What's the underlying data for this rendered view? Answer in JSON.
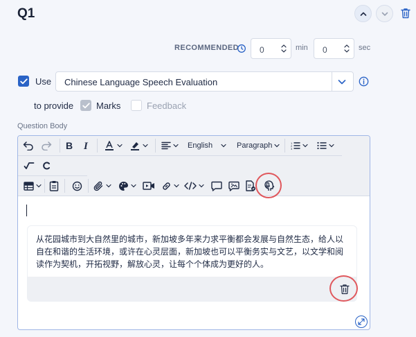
{
  "question": {
    "title": "Q1"
  },
  "timing": {
    "recommended_label": "RECOMMENDED",
    "minutes_value": "0",
    "minutes_unit": "min",
    "seconds_value": "0",
    "seconds_unit": "sec"
  },
  "use_row": {
    "checkbox_checked": true,
    "use_label": "Use",
    "selected_option": "Chinese Language Speech Evaluation"
  },
  "provide_row": {
    "label": "to provide",
    "marks_label": "Marks",
    "marks_checked": true,
    "feedback_label": "Feedback",
    "feedback_checked": false
  },
  "body": {
    "label": "Question Body"
  },
  "toolbar": {
    "language": "English",
    "block_format": "Paragraph",
    "icons": [
      "undo-icon",
      "redo-icon",
      "bold-icon",
      "italic-icon",
      "font-color-icon",
      "highlight-icon",
      "align-icon",
      "numbered-list-icon",
      "bullet-list-icon",
      "square-root-icon",
      "chemistry-icon",
      "table-icon",
      "paste-icon",
      "emoji-icon",
      "attachment-icon",
      "palette-icon",
      "video-icon",
      "link-icon",
      "code-icon",
      "comment-icon",
      "image-comment-icon",
      "document-icon",
      "speech-icon"
    ]
  },
  "content": {
    "passage": "从花园城市到大自然里的城市，新加坡多年来力求平衡都会发展与自然生态，给人以自在和谐的生活环境，或许在心灵层面，新加坡也可以平衡务实与文艺，以文学和阅读作为契机，开拓视野，解放心灵，让每个个体成为更好的人。"
  },
  "colors": {
    "accent": "#2a63c6",
    "highlight_ring": "#e0575c",
    "page_bg": "#f4f6fb",
    "toolbar_bg": "#eef0f4"
  }
}
